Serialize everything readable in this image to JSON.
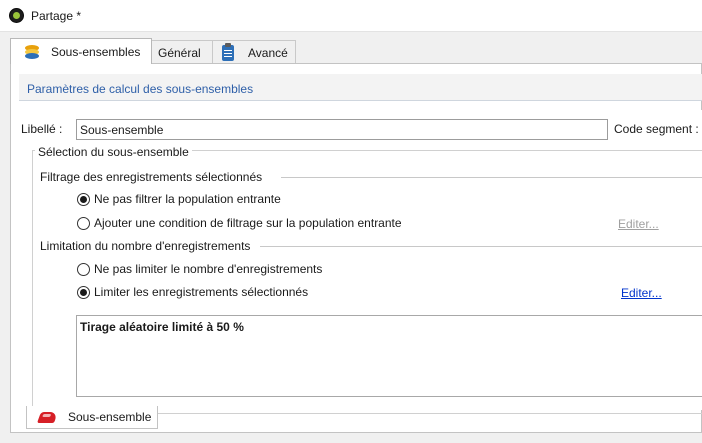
{
  "window": {
    "title": "Partage *"
  },
  "tabs": [
    {
      "label": "Sous-ensembles",
      "icon": "database-icon"
    },
    {
      "label": "Général"
    },
    {
      "label": "Avancé",
      "icon": "clipboard-icon"
    }
  ],
  "section": {
    "header": "Paramètres de calcul des sous-ensembles"
  },
  "form": {
    "libelle_label": "Libellé :",
    "libelle_value": "Sous-ensemble",
    "code_segment_label": "Code segment :"
  },
  "selection": {
    "legend": "Sélection du sous-ensemble",
    "filtrage": {
      "title": "Filtrage des enregistrements sélectionnés",
      "options": [
        {
          "label": "Ne pas filtrer la population entrante",
          "checked": true
        },
        {
          "label": "Ajouter une condition de filtrage sur la population entrante",
          "checked": false
        }
      ],
      "edit_link": "Editer..."
    },
    "limitation": {
      "title": "Limitation du nombre d'enregistrements",
      "options": [
        {
          "label": "Ne pas limiter le nombre d'enregistrements",
          "checked": false
        },
        {
          "label": "Limiter les enregistrements sélectionnés",
          "checked": true
        }
      ],
      "edit_link": "Editer...",
      "summary": "Tirage aléatoire limité à 50 %"
    }
  },
  "bottom_tabs": [
    {
      "label": "Sous-ensemble",
      "icon": "subset-icon"
    }
  ],
  "colors": {
    "link": "#0033cc",
    "header_text": "#2e5fa8",
    "disabled_link": "#a0a0a0",
    "subset_icon": "#d61f26"
  }
}
